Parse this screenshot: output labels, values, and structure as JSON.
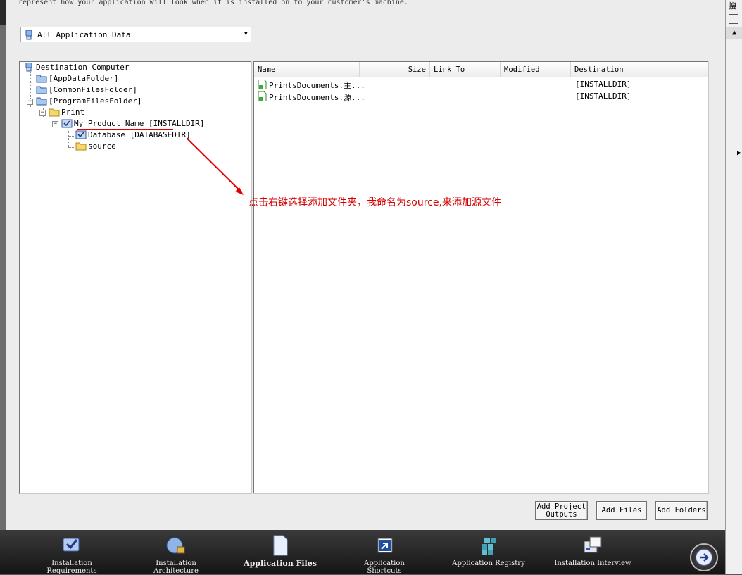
{
  "description": "represent how your application will look when it is installed on to your customer's machine.",
  "view_select": {
    "value": "All Application Data"
  },
  "tree": {
    "root": "Destination Computer",
    "appdata": "[AppDataFolder]",
    "commonfiles": "[CommonFilesFolder]",
    "programfiles": "[ProgramFilesFolder]",
    "print": "Print",
    "product": "My Product Name [INSTALLDIR]",
    "database": "Database [DATABASEDIR]",
    "source": "source"
  },
  "columns": {
    "name": "Name",
    "size": "Size",
    "link_to": "Link To",
    "modified": "Modified",
    "destination": "Destination"
  },
  "files": [
    {
      "name": "PrintsDocuments.主...",
      "destination": "[INSTALLDIR]"
    },
    {
      "name": "PrintsDocuments.源...",
      "destination": "[INSTALLDIR]"
    }
  ],
  "buttons": {
    "add_project_outputs": "Add Project Outputs",
    "add_files": "Add Files",
    "add_folders": "Add Folders"
  },
  "annotation": "点击右键选择添加文件夹，我命名为source,来添加源文件",
  "nav": {
    "requirements": "Installation Requirements",
    "architecture": "Installation Architecture",
    "files": "Application Files",
    "shortcuts": "Application Shortcuts",
    "registry": "Application Registry",
    "interview": "Installation Interview"
  },
  "side_char": "搜",
  "colors": {
    "annotation": "#e00000",
    "accent": "#1e5aa8"
  }
}
